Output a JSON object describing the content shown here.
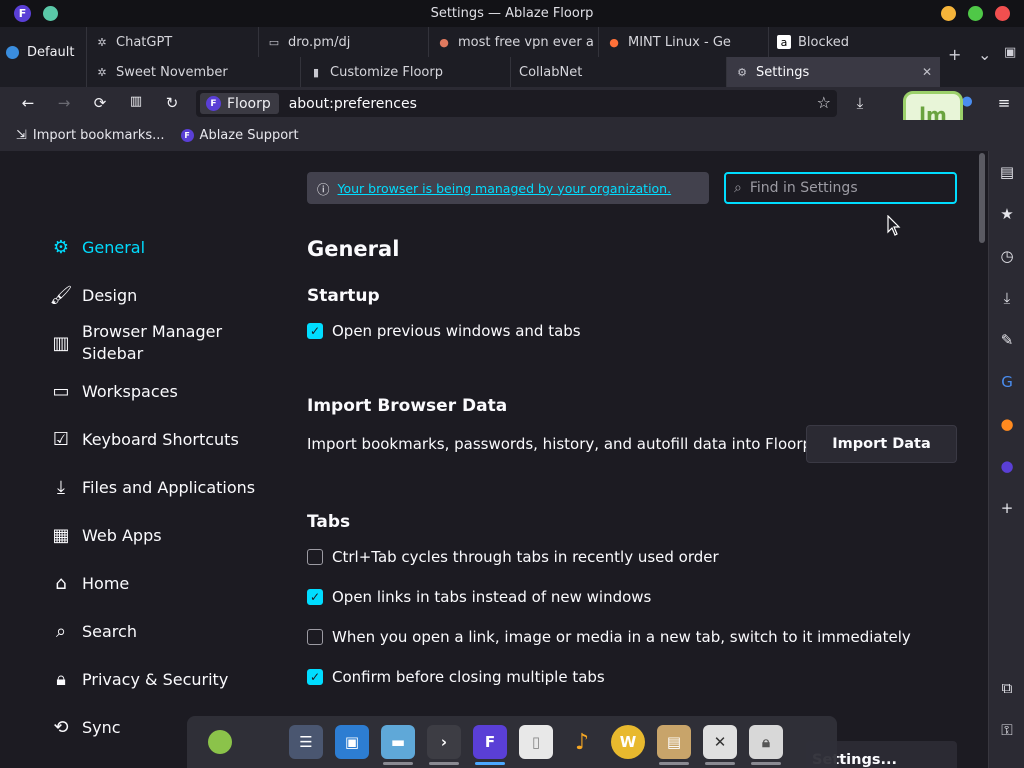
{
  "window": {
    "title": "Settings — Ablaze Floorp",
    "buttons": [
      "minimize",
      "maximize",
      "close"
    ]
  },
  "tabstrip": {
    "workspace": "Default",
    "tabs_row1": [
      {
        "label": "ChatGPT",
        "icon": "chatgpt-icon"
      },
      {
        "label": "dro.pm/dj",
        "icon": "folder-icon"
      },
      {
        "label": "most free vpn ever a",
        "icon": "site-icon"
      },
      {
        "label": "MINT Linux - Ge",
        "icon": "firefox-icon"
      },
      {
        "label": "Blocked",
        "icon": "amazon-icon"
      }
    ],
    "tabs_row2": [
      {
        "label": "Sweet November",
        "icon": "chatgpt-icon"
      },
      {
        "label": "Customize Floorp",
        "icon": "paint-icon"
      },
      {
        "label": "CollabNet",
        "icon": ""
      },
      {
        "label": "Settings",
        "icon": "gear-icon",
        "active": true
      }
    ],
    "new_tab": "+",
    "overflow": "⌄"
  },
  "navbar": {
    "identity_label": "Floorp",
    "url": "about:preferences"
  },
  "bookmarks": [
    {
      "label": "Import bookmarks...",
      "icon": "import-icon"
    },
    {
      "label": "Ablaze Support",
      "icon": "floorp-icon"
    }
  ],
  "policy_notice": "Your browser is being managed by your organization.",
  "search": {
    "placeholder": "Find in Settings"
  },
  "categories": [
    {
      "label": "General",
      "icon": "gear-icon",
      "selected": true
    },
    {
      "label": "Design",
      "icon": "paint-icon"
    },
    {
      "label": "Browser Manager Sidebar",
      "icon": "sidebar-icon"
    },
    {
      "label": "Workspaces",
      "icon": "workspace-icon"
    },
    {
      "label": "Keyboard Shortcuts",
      "icon": "keyboard-icon"
    },
    {
      "label": "Files and Applications",
      "icon": "download-icon"
    },
    {
      "label": "Web Apps",
      "icon": "webapps-icon"
    },
    {
      "label": "Home",
      "icon": "home-icon"
    },
    {
      "label": "Search",
      "icon": "search-icon"
    },
    {
      "label": "Privacy & Security",
      "icon": "lock-icon"
    },
    {
      "label": "Sync",
      "icon": "sync-icon"
    }
  ],
  "main": {
    "page_title": "General",
    "startup": {
      "heading": "Startup",
      "restore": {
        "label": "Open previous windows and tabs",
        "checked": true
      }
    },
    "import": {
      "heading": "Import Browser Data",
      "description": "Import bookmarks, passwords, history, and autofill data into Floorp.",
      "button": "Import Data"
    },
    "tabs": {
      "heading": "Tabs",
      "options": [
        {
          "label": "Ctrl+Tab cycles through tabs in recently used order",
          "checked": false
        },
        {
          "label": "Open links in tabs instead of new windows",
          "checked": true
        },
        {
          "label": "When you open a link, image or media in a new tab, switch to it immediately",
          "checked": false
        },
        {
          "label": "Confirm before closing multiple tabs",
          "checked": true
        }
      ]
    },
    "partial_button": "Settings..."
  },
  "dock": [
    "mint-menu-icon",
    "settings-icon",
    "store-icon",
    "files-icon",
    "terminal-icon",
    "floorp-icon",
    "text-editor-icon",
    "notes-icon",
    "wps-icon",
    "archive-icon",
    "xed-icon",
    "lock-screen-icon"
  ],
  "colors": {
    "accent": "#00ddff",
    "background": "#1c1b22",
    "toolbar": "#2b2a33"
  }
}
